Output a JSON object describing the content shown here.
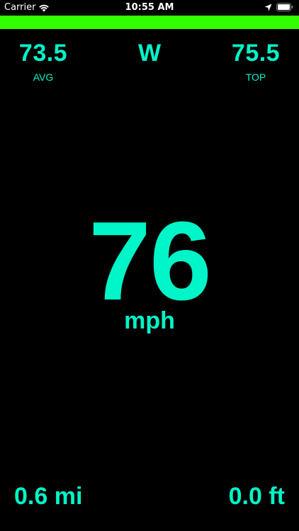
{
  "status_bar": {
    "carrier": "Carrier",
    "time": "10:55 AM",
    "icons": [
      "wifi-icon",
      "location-icon",
      "battery-icon"
    ]
  },
  "gps_bar": {
    "color": "#33ff00"
  },
  "stats": {
    "avg_value": "73.5",
    "avg_label": "AVG",
    "heading": "W",
    "top_value": "75.5",
    "top_label": "TOP"
  },
  "speed": {
    "value": "76",
    "unit": "mph"
  },
  "trip": {
    "distance": "0.6 mi",
    "altitude": "0.0 ft"
  },
  "colors": {
    "accent": "#00f5c8",
    "background": "#000000",
    "status_text": "#ffffff"
  }
}
